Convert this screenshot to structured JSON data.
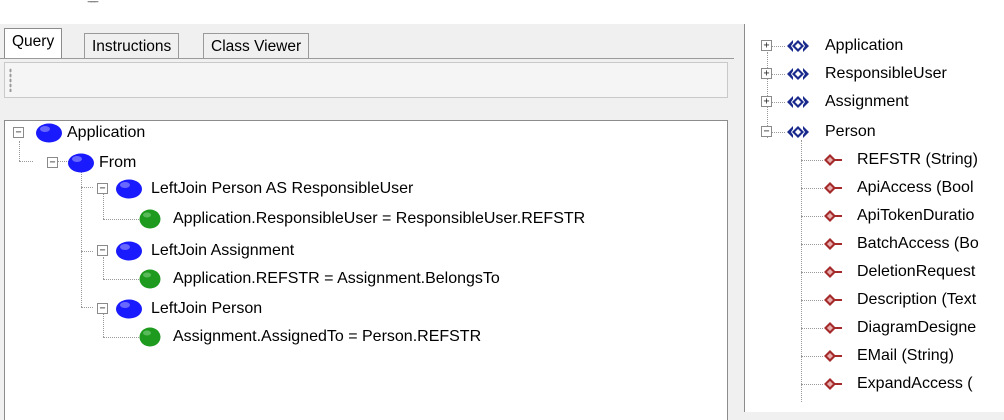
{
  "top": {
    "glyph": "‾‾‾"
  },
  "tabs": [
    {
      "label": "Query",
      "active": true
    },
    {
      "label": "Instructions",
      "active": false
    },
    {
      "label": "Class Viewer",
      "active": false
    }
  ],
  "query_tree": {
    "root": "Application",
    "from": "From",
    "joins": [
      {
        "label": "LeftJoin  Person AS ResponsibleUser",
        "condition": "Application.ResponsibleUser = ResponsibleUser.REFSTR"
      },
      {
        "label": "LeftJoin  Assignment",
        "condition": "Application.REFSTR = Assignment.BelongsTo"
      },
      {
        "label": "LeftJoin  Person",
        "condition": "Assignment.AssignedTo = Person.REFSTR"
      }
    ]
  },
  "class_tree": {
    "classes": [
      "Application",
      "ResponsibleUser",
      "Assignment",
      "Person"
    ],
    "attributes": [
      "REFSTR (String)",
      "ApiAccess (Bool",
      "ApiTokenDuratio",
      "BatchAccess (Bo",
      "DeletionRequest",
      "Description (Text",
      "DiagramDesigne",
      "EMail (String)",
      "ExpandAccess ("
    ]
  },
  "colors": {
    "node_blue": "#1a1aff",
    "node_green": "#1e9a1e",
    "class_icon": "#1a2a8c",
    "attr_icon": "#a52a2a"
  }
}
